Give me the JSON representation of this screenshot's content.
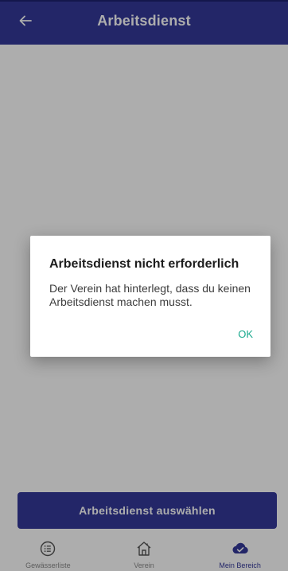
{
  "appbar": {
    "title": "Arbeitsdienst",
    "back_icon": "arrow-left-icon",
    "color": "#34399a"
  },
  "main": {
    "primary_button_label": "Arbeitsdienst auswählen"
  },
  "bottom_nav": {
    "items": [
      {
        "label": "Gewässerliste",
        "icon": "list-icon",
        "active": false
      },
      {
        "label": "Verein",
        "icon": "home-icon",
        "active": false
      },
      {
        "label": "Mein Bereich",
        "icon": "cloud-check-icon",
        "active": true
      }
    ],
    "active_color": "#34399a"
  },
  "dialog": {
    "title": "Arbeitsdienst nicht erforderlich",
    "message": "Der Verein hat hinterlegt, dass du keinen Arbeitsdienst machen musst.",
    "ok_label": "OK",
    "ok_color": "#19a98d"
  }
}
